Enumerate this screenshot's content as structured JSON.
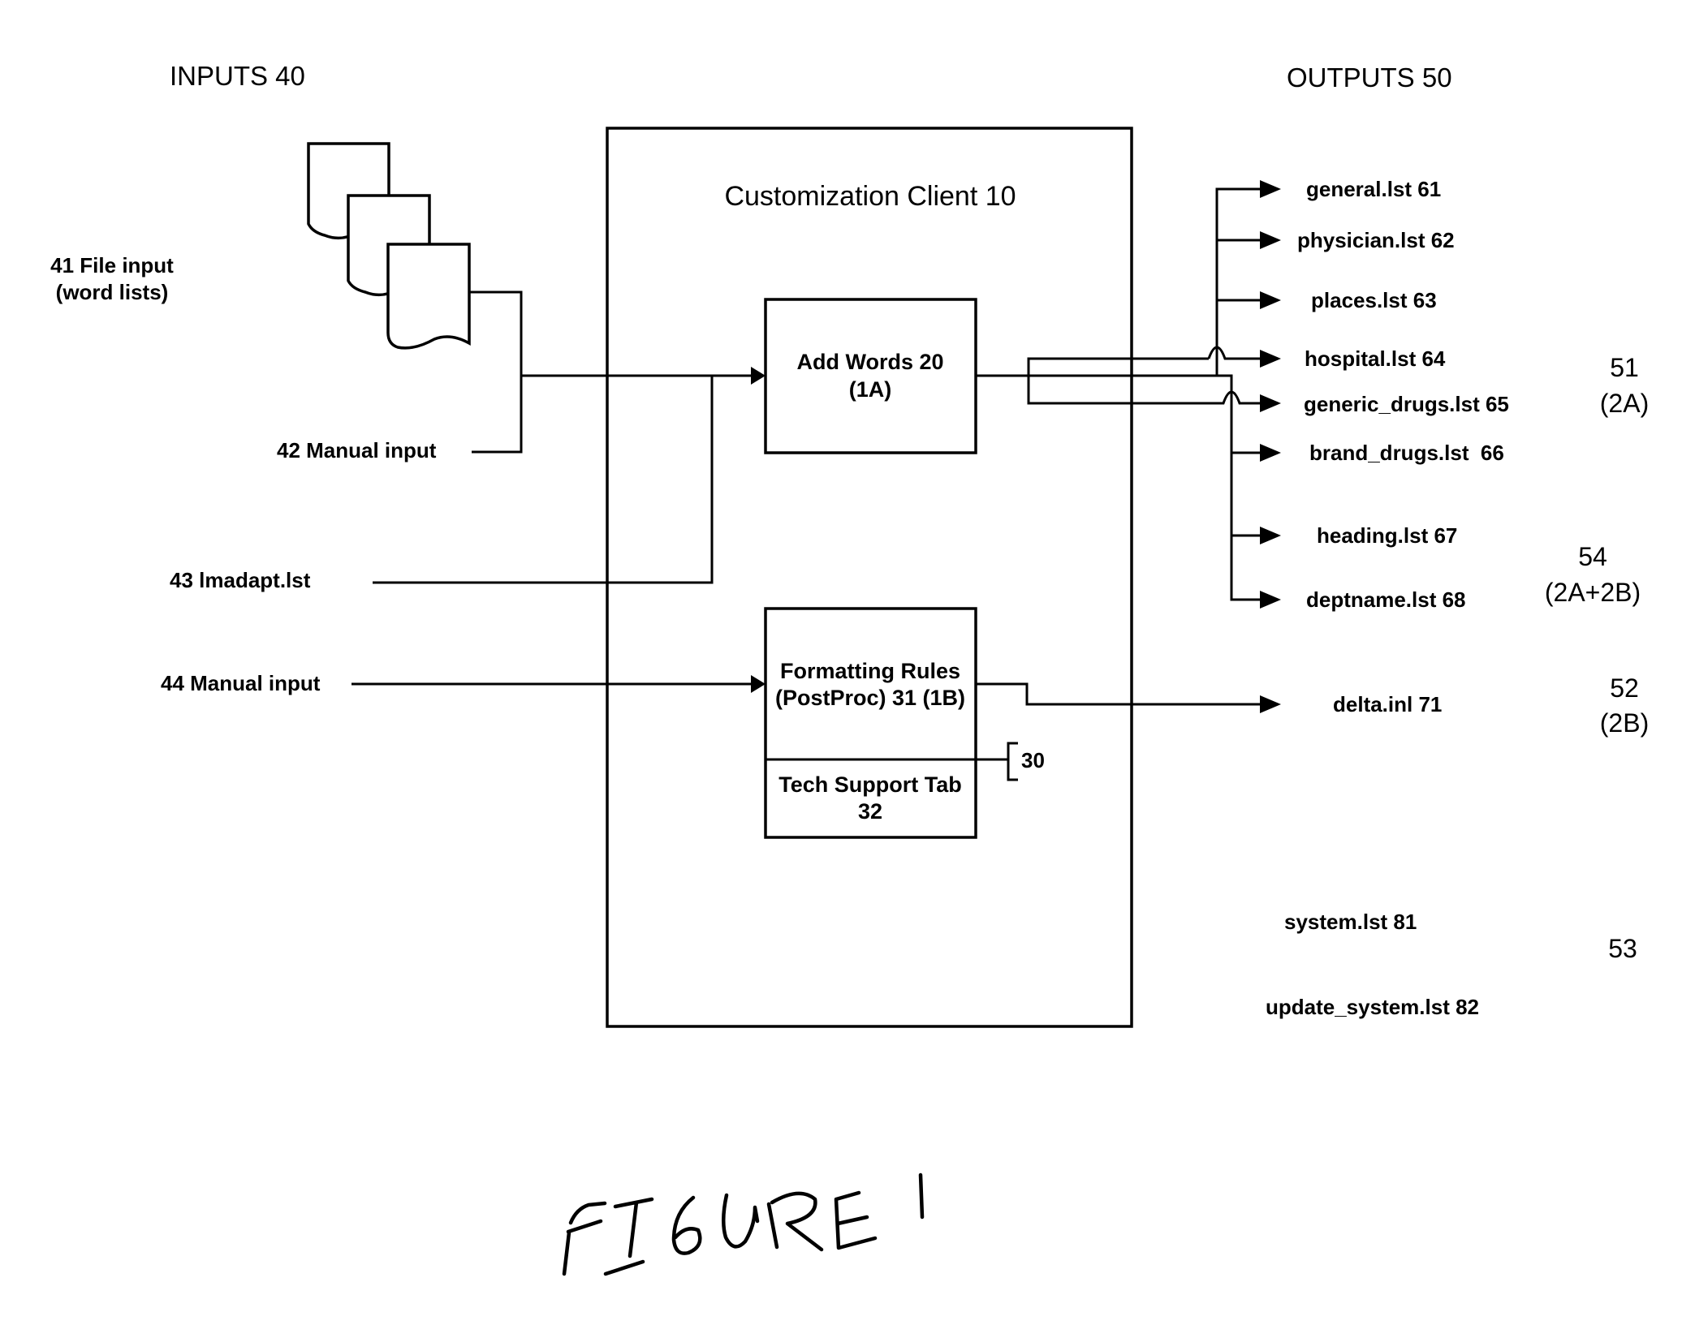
{
  "figure": {
    "caption": "FIGURE 1",
    "inputs_header": "INPUTS 40",
    "outputs_header": "OUTPUTS 50"
  },
  "client": {
    "title": "Customization Client 10",
    "add_words": {
      "line1": "Add Words 20",
      "line2": "(1A)"
    },
    "formatting": {
      "line1": "Formatting Rules",
      "line2": "(PostProc) 31 (1B)"
    },
    "tech_support": {
      "line1": "Tech Support Tab",
      "line2": "32"
    },
    "bracket_label": "30"
  },
  "inputs": {
    "file_input": {
      "line1": "41 File input",
      "line2": "(word lists)",
      "icon": "stacked-documents-icon"
    },
    "manual_input_42": "42 Manual input",
    "lmadapt": "43 lmadapt.lst",
    "manual_input_44": "44 Manual input"
  },
  "outputs": {
    "word_lists": [
      "general.lst 61",
      "physician.lst 62",
      "places.lst 63",
      "hospital.lst 64",
      "generic_drugs.lst 65",
      "brand_drugs.lst  66",
      "heading.lst 67",
      "deptname.lst 68"
    ],
    "delta": "delta.inl 71",
    "system": "system.lst 81",
    "update_system": "update_system.lst 82"
  },
  "groups": {
    "g51": {
      "num": "51",
      "sub": "(2A)"
    },
    "g54": {
      "num": "54",
      "sub": "(2A+2B)"
    },
    "g52": {
      "num": "52",
      "sub": "(2B)"
    },
    "g53": {
      "num": "53"
    }
  }
}
